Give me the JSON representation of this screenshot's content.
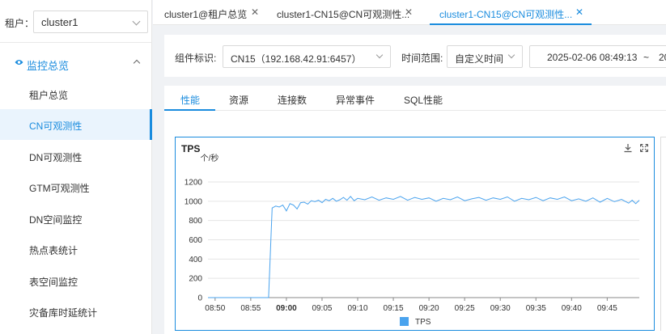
{
  "sidebar": {
    "tenant_label": "租户：",
    "tenant_value": "cluster1",
    "group_label": "监控总览",
    "items": [
      {
        "label": "租户总览"
      },
      {
        "label": "CN可观测性"
      },
      {
        "label": "DN可观测性"
      },
      {
        "label": "GTM可观测性"
      },
      {
        "label": "DN空间监控"
      },
      {
        "label": "热点表统计"
      },
      {
        "label": "表空间监控"
      },
      {
        "label": "灾备库时延统计"
      }
    ]
  },
  "page_tabs": [
    {
      "label": "cluster1@租户总览",
      "close": "✕"
    },
    {
      "label": "cluster1-CN15@CN可观测性...",
      "close": "✕"
    },
    {
      "label": "cluster1-CN15@CN可观测性...",
      "close": "✕"
    }
  ],
  "filters": {
    "component_label": "组件标识:",
    "component_value": "CN15（192.168.42.91:6457）",
    "time_label": "时间范围:",
    "time_value": "自定义时间",
    "start_time": "2025-02-06 08:49:13",
    "separator": "~",
    "end_time_partial": "20"
  },
  "sub_tabs": [
    "性能",
    "资源",
    "连接数",
    "异常事件",
    "SQL性能"
  ],
  "colors": {
    "accent": "#1a8cde",
    "series": "#4aa3ee"
  },
  "chart": {
    "title": "TPS",
    "icons": [
      "download-icon",
      "fullscreen-icon"
    ]
  },
  "chart_data": {
    "type": "line",
    "title": "TPS",
    "ylabel": "个/秒",
    "ylim": [
      0,
      1200
    ],
    "yticks": [
      0,
      200,
      400,
      600,
      800,
      1000,
      1200
    ],
    "xticks": [
      "08:50",
      "08:55",
      "09:00",
      "09:05",
      "09:10",
      "09:15",
      "09:20",
      "09:25",
      "09:30",
      "09:35",
      "09:40",
      "09:45"
    ],
    "xlim_minutes": [
      -1,
      59.5
    ],
    "legend": "bottom-center",
    "grid": "horizontal",
    "series": [
      {
        "name": "TPS",
        "x_minutes": [
          -1,
          7.5,
          8,
          8.5,
          9,
          9.5,
          10,
          10.5,
          11,
          11.5,
          12,
          12.5,
          13,
          13.5,
          14,
          14.5,
          15,
          15.5,
          16,
          16.5,
          17,
          17.5,
          18,
          18.5,
          19,
          19.5,
          20,
          21,
          22,
          23,
          24,
          25,
          26,
          27,
          28,
          29,
          30,
          31,
          32,
          33,
          34,
          35,
          36,
          37,
          38,
          39,
          40,
          41,
          42,
          43,
          44,
          45,
          46,
          47,
          48,
          49,
          50,
          51,
          52,
          53,
          54,
          55,
          56,
          57,
          58,
          58.5,
          59,
          59.5
        ],
        "y": [
          0,
          0,
          930,
          950,
          940,
          960,
          900,
          975,
          960,
          920,
          985,
          990,
          970,
          1005,
          995,
          1010,
          985,
          1020,
          1005,
          1030,
          1000,
          1015,
          1040,
          1010,
          1050,
          1005,
          1030,
          1015,
          1045,
          1010,
          1035,
          1020,
          1050,
          1010,
          1040,
          1020,
          1035,
          1000,
          1030,
          1015,
          1045,
          1005,
          1025,
          1040,
          1010,
          1035,
          1020,
          1045,
          1000,
          1030,
          1015,
          1040,
          1005,
          1035,
          1020,
          1045,
          1005,
          1025,
          1000,
          1035,
          990,
          1030,
          995,
          1020,
          980,
          1010,
          975,
          1010
        ]
      }
    ]
  }
}
